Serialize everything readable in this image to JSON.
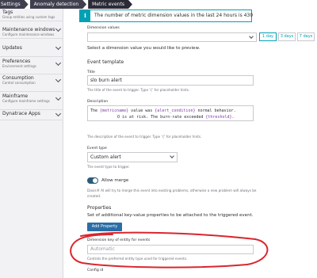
{
  "breadcrumb": [
    "Settings",
    "Anomaly detection",
    "Metric events"
  ],
  "sidebar": {
    "items": [
      {
        "title": "Tags",
        "subtitle": "Group entities using custom tags"
      },
      {
        "title": "Maintenance windows",
        "subtitle": "Configure maintenance windows"
      },
      {
        "title": "Updates",
        "subtitle": ""
      },
      {
        "title": "Preferences",
        "subtitle": "Environment settings"
      },
      {
        "title": "Consumption",
        "subtitle": "Control consumption"
      },
      {
        "title": "Mainframe",
        "subtitle": "Configure mainframe settings"
      },
      {
        "title": "Dynatrace Apps",
        "subtitle": ""
      }
    ]
  },
  "info_bar": {
    "icon": "info-icon",
    "text": "The number of metric dimension values in the last 24 hours is 430"
  },
  "dimension_values": {
    "label": "Dimension values",
    "value": "",
    "hint": "Select a dimension value you would like to preview.",
    "range_buttons": [
      "1 day",
      "3 days",
      "7 days"
    ],
    "selected_range": "1 day"
  },
  "event_template": {
    "heading": "Event template",
    "title_label": "Title",
    "title_value": "slo burn alert",
    "title_hint": "The title of the event to trigger. Type '{' for placeholder hints.",
    "description_label": "Description",
    "description_line1_a": "The ",
    "description_line1_metric": "{metricname}",
    "description_line1_b": " value was ",
    "description_line1_cond": "{alert_condition}",
    "description_line1_c": " normal behavior.",
    "description_line2_a": "O is at risk. The burn-rate exceeded ",
    "description_line2_thr": "{threshold}",
    "description_line2_b": ".",
    "description_hint": "The description of the event to trigger. Type '{' for placeholder hints.",
    "event_type_label": "Event type",
    "event_type_value": "Custom alert",
    "event_type_hint": "The event type to trigger."
  },
  "allow_merge": {
    "label": "Allow merge",
    "enabled": true,
    "hint_line1": "Davis® AI will try to merge this event into existing problems, otherwise a new problem will always be",
    "hint_line2": "created."
  },
  "properties": {
    "heading": "Properties",
    "description": "Set of additional key-value properties to be attached to the triggered event.",
    "add_button": "Add Property"
  },
  "dimension_key": {
    "label": "Dimension key of entity for events",
    "placeholder": "Automatic",
    "hint": "Controls the preferred entity type used for triggered events."
  },
  "config_id": {
    "label": "Config id"
  },
  "colors": {
    "accent": "#00a1b2",
    "primary_button": "#2a6ea5",
    "annotation": "#d9262e"
  }
}
